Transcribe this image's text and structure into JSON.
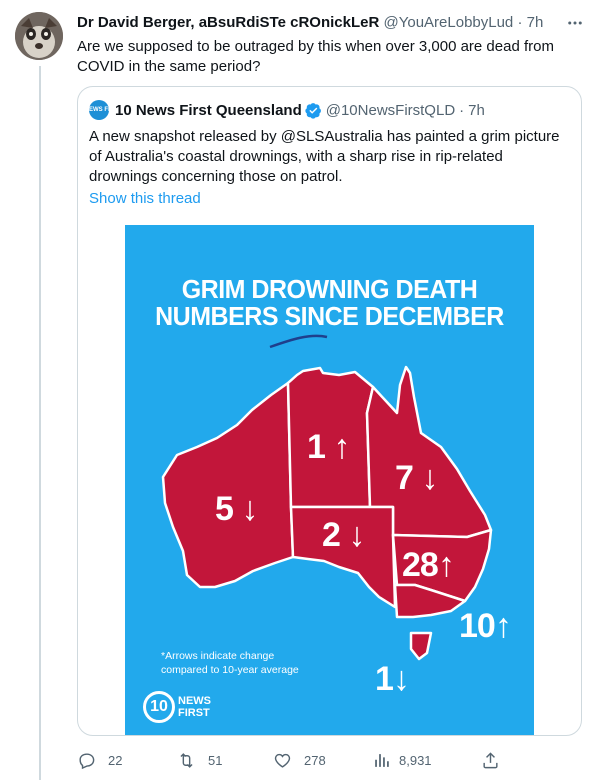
{
  "tweet": {
    "author_name": "Dr David Berger, aBsuRdiSTe cROnickLeR",
    "author_handle": "@YouAreLobbyLud",
    "separator": "·",
    "time": "7h",
    "text": "Are we supposed to be outraged by this when over 3,000 are dead from COVID in the same period?"
  },
  "quote": {
    "avatar_text": "10 NEWS FIRST",
    "author_name": "10 News First Queensland",
    "author_handle": "@10NewsFirstQLD",
    "separator": "·",
    "time": "7h",
    "text": "A new snapshot released by @SLSAustralia has painted a grim picture of Australia's coastal drownings, with a sharp rise in rip-related drownings concerning those on patrol.",
    "show_thread": "Show this thread",
    "graphic": {
      "title_line1": "GRIM DROWNING DEATH",
      "title_line2": "NUMBERS SINCE DECEMBER",
      "states": [
        {
          "label": "WA",
          "value": "5",
          "arrow": "↓"
        },
        {
          "label": "NT",
          "value": "1",
          "arrow": "↑"
        },
        {
          "label": "QLD",
          "value": "7",
          "arrow": "↓"
        },
        {
          "label": "SA",
          "value": "2",
          "arrow": "↓"
        },
        {
          "label": "NSW",
          "value": "28",
          "arrow": "↑"
        },
        {
          "label": "VIC",
          "value": "10",
          "arrow": "↑"
        },
        {
          "label": "TAS",
          "value": "1",
          "arrow": "↓"
        }
      ],
      "note_line1": "*Arrows indicate change",
      "note_line2": "compared to 10-year average",
      "logo_mark": "10",
      "logo_line1": "NEWS",
      "logo_line2": "FIRST",
      "colors": {
        "background": "#22a9ec",
        "map": "#c2163a",
        "map_border": "#ffffff"
      }
    }
  },
  "actions": {
    "replies": "22",
    "retweets": "51",
    "likes": "278",
    "views": "8,931"
  },
  "colors": {
    "accent": "#1d9bf0",
    "secondary_text": "#536471",
    "border": "#cfd9de"
  }
}
